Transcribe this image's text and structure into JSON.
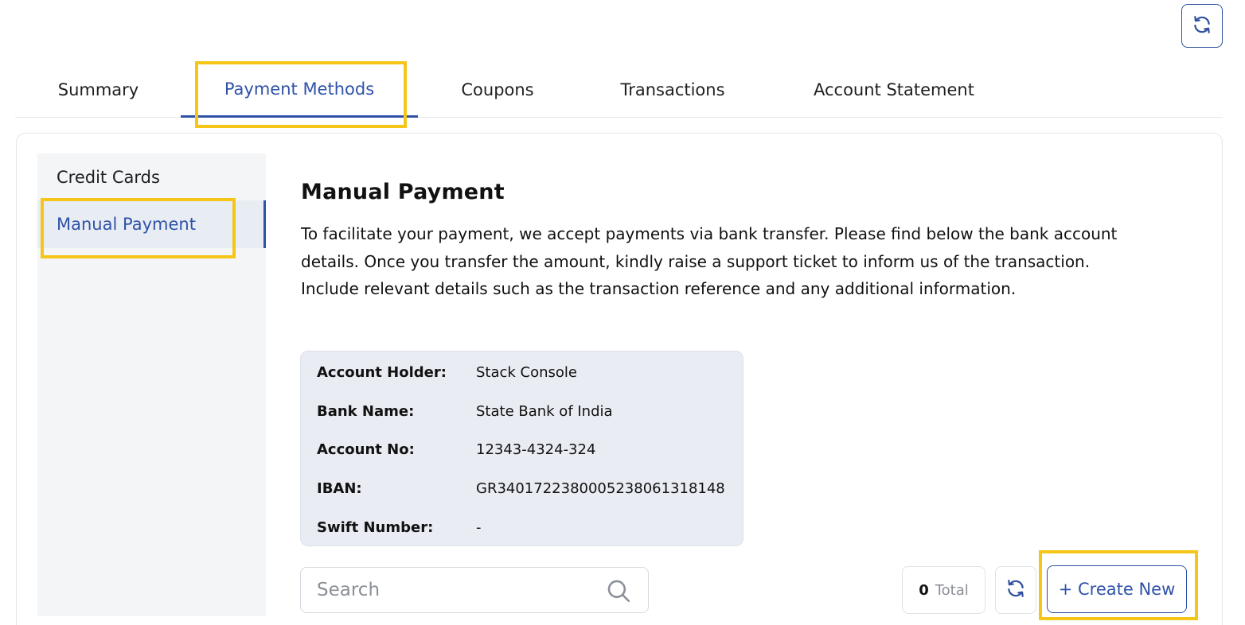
{
  "header": {
    "refresh_icon": "refresh-icon"
  },
  "tabs": [
    {
      "label": "Summary"
    },
    {
      "label": "Payment Methods",
      "active": true
    },
    {
      "label": "Coupons"
    },
    {
      "label": "Transactions"
    },
    {
      "label": "Account Statement"
    }
  ],
  "sidebar": {
    "items": [
      {
        "label": "Credit Cards"
      },
      {
        "label": "Manual Payment",
        "active": true
      }
    ]
  },
  "main": {
    "title": "Manual Payment",
    "description": "To facilitate your payment, we accept payments via bank transfer. Please find below the bank account details. Once you transfer the amount, kindly raise a support ticket to inform us of the transaction. Include relevant details such as the transaction reference and any additional information.",
    "bank_details": [
      {
        "label": "Account Holder:",
        "value": "Stack Console"
      },
      {
        "label": "Bank Name:",
        "value": "State Bank of India"
      },
      {
        "label": "Account No:",
        "value": "12343-4324-324"
      },
      {
        "label": "IBAN:",
        "value": "GR3401722380005238061318148"
      },
      {
        "label": "Swift Number:",
        "value": "-"
      }
    ]
  },
  "toolbar": {
    "search_placeholder": "Search",
    "total_count": "0",
    "total_label": "Total",
    "create_label": "+ Create New"
  },
  "colors": {
    "accent": "#2f52a8",
    "highlight": "#f5c518",
    "bank_box_bg": "#e9ecf3"
  }
}
